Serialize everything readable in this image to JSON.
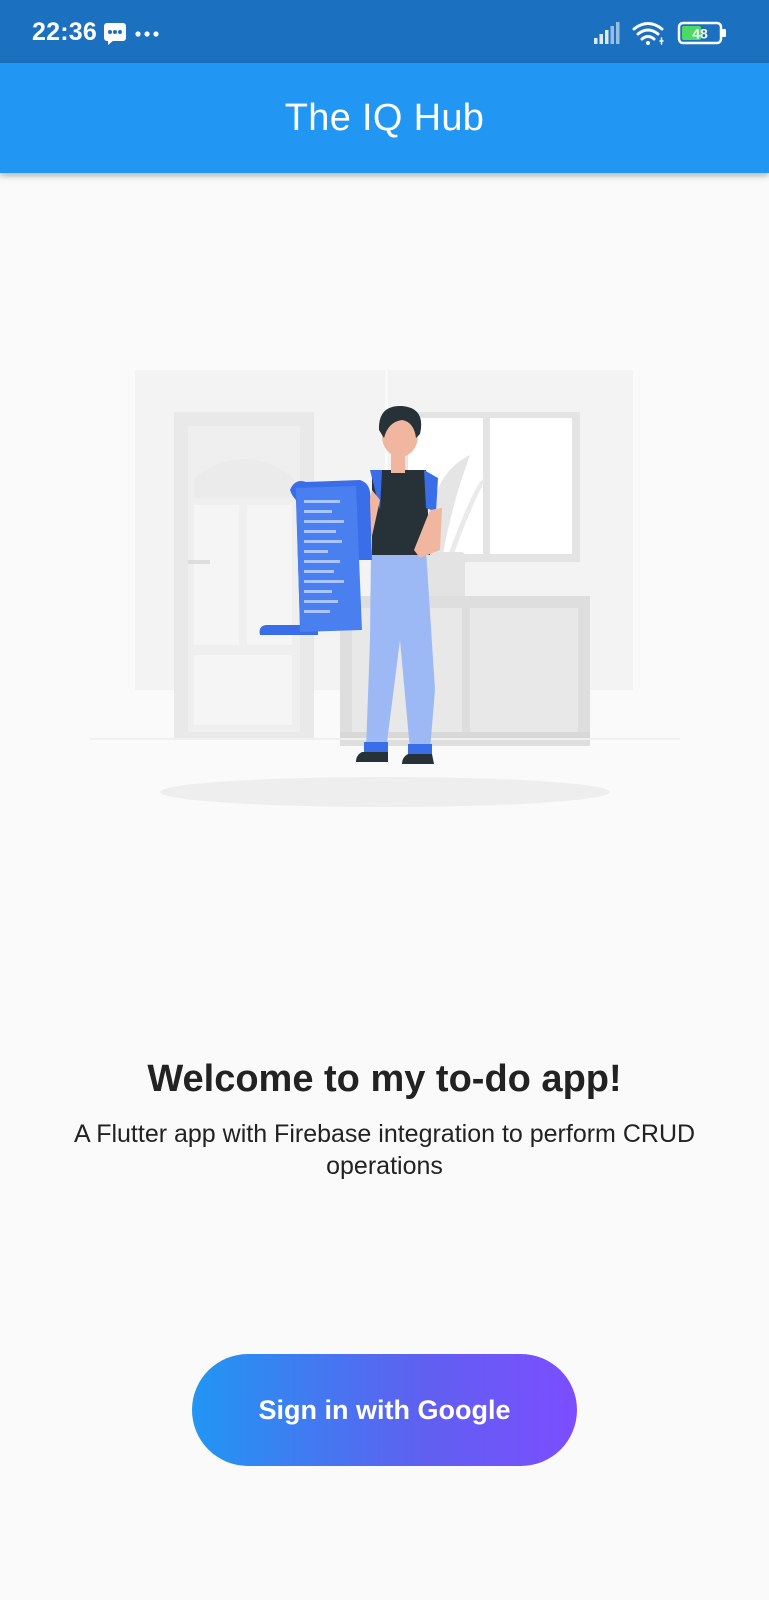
{
  "status_bar": {
    "time": "22:36",
    "battery_level": "48",
    "icons": [
      "message-icon",
      "more-dots-icon",
      "signal-icon",
      "wifi-icon",
      "battery-icon"
    ]
  },
  "app_bar": {
    "title": "The IQ Hub"
  },
  "illustration": {
    "description_icon": "person-with-todo-list-illustration"
  },
  "welcome": {
    "title": "Welcome to my to-do app!",
    "subtitle": "A Flutter app with Firebase integration to perform CRUD operations"
  },
  "sign_in_button": {
    "label": "Sign in with Google"
  },
  "colors": {
    "status_bar": "#1b70bf",
    "app_bar": "#2196f3",
    "background": "#fafafa",
    "button_gradient_start": "#2196f3",
    "button_gradient_end": "#7c4dff",
    "illustration_accent": "#3a6ee8"
  }
}
